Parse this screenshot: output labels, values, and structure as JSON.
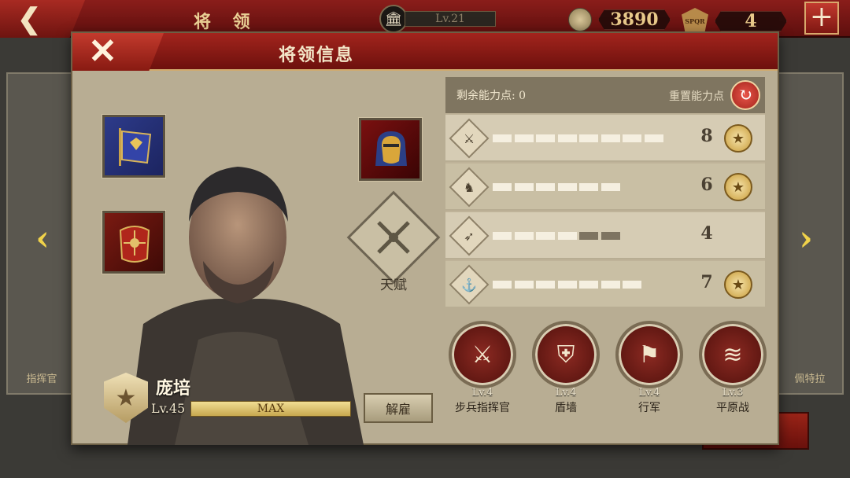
{
  "topbar": {
    "title": "将 领",
    "level": "Lv.21",
    "coins": "3890",
    "spqr_label": "SPQR",
    "spqr_count": "4",
    "back_icon": "chevron-left-icon",
    "plus_icon": "plus-icon"
  },
  "background": {
    "left_card_name": "指挥官",
    "right_card_name": "佩特拉"
  },
  "panel": {
    "title": "将领信息",
    "close_icon": "close-icon"
  },
  "general": {
    "name": "庞培",
    "level": "Lv.45",
    "xp_label": "MAX",
    "xp_fraction": 1.0,
    "dismiss_label": "解雇",
    "talent_label": "天赋"
  },
  "stats": {
    "points_label": "剩余能力点: 0",
    "reset_label": "重置能力点",
    "rows": [
      {
        "icon": "sword-icon",
        "value": "8",
        "filled": 8,
        "total": 8,
        "medal": true
      },
      {
        "icon": "horse-icon",
        "value": "6",
        "filled": 6,
        "total": 6,
        "medal": true
      },
      {
        "icon": "bow-icon",
        "value": "4",
        "filled": 4,
        "total": 6,
        "medal": false
      },
      {
        "icon": "anchor-icon",
        "value": "7",
        "filled": 7,
        "total": 7,
        "medal": true
      }
    ]
  },
  "skills": [
    {
      "icon": "crossed-swords-icon",
      "level": "Lv.4",
      "name": "步兵指挥官"
    },
    {
      "icon": "shield-wall-icon",
      "level": "Lv.4",
      "name": "盾墙"
    },
    {
      "icon": "marching-icon",
      "level": "Lv.4",
      "name": "行军"
    },
    {
      "icon": "plains-icon",
      "level": "Lv.3",
      "name": "平原战"
    }
  ],
  "colors": {
    "header_red": "#8a1d1a",
    "gold": "#e8c98a",
    "panel_bg": "#b8ad93"
  }
}
